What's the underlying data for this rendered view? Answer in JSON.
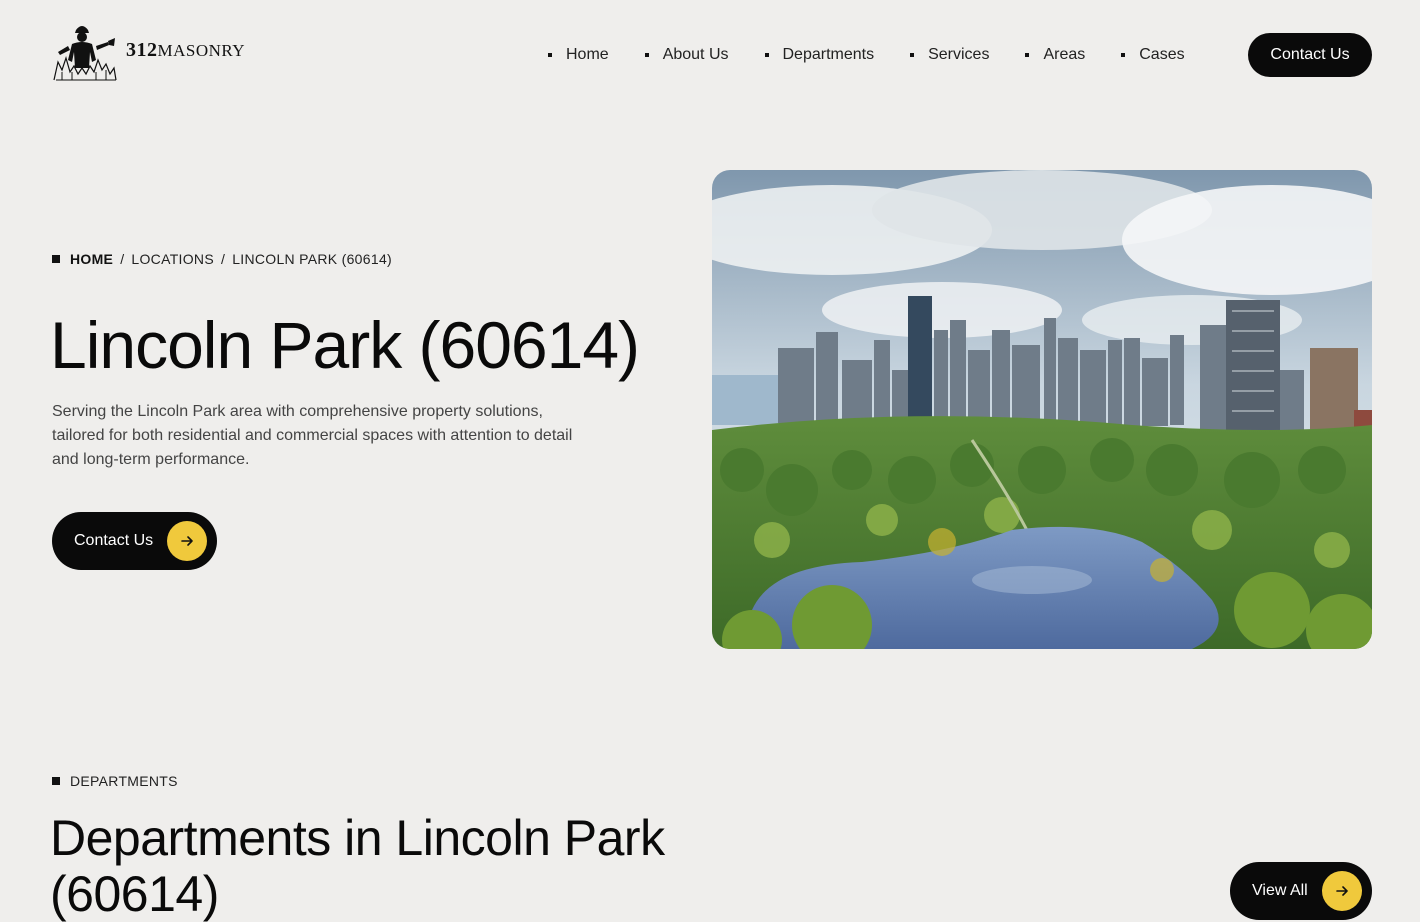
{
  "brand": {
    "logo_number": "312",
    "logo_name": "MASONRY",
    "logo_icon": "worker-silhouette-icon"
  },
  "nav": {
    "items": [
      {
        "label": "Home"
      },
      {
        "label": "About Us"
      },
      {
        "label": "Departments"
      },
      {
        "label": "Services"
      },
      {
        "label": "Areas"
      },
      {
        "label": "Cases"
      }
    ],
    "cta_label": "Contact Us"
  },
  "hero": {
    "breadcrumb": [
      "HOME",
      "LOCATIONS",
      "LINCOLN PARK (60614)"
    ],
    "breadcrumb_separator": "/",
    "title": "Lincoln Park (60614)",
    "description": "Serving the Lincoln Park area with comprehensive property solutions, tailored for both residential and commercial spaces with attention to detail and long-term performance.",
    "cta_label": "Contact Us",
    "cta_icon": "arrow-right-icon"
  },
  "departments": {
    "tag": "DEPARTMENTS",
    "title": "Departments in Lincoln Park (60614)",
    "view_all_label": "View All"
  },
  "colors": {
    "background": "#efeeec",
    "primary": "#0a0a0a",
    "accent": "#f0c93c"
  }
}
